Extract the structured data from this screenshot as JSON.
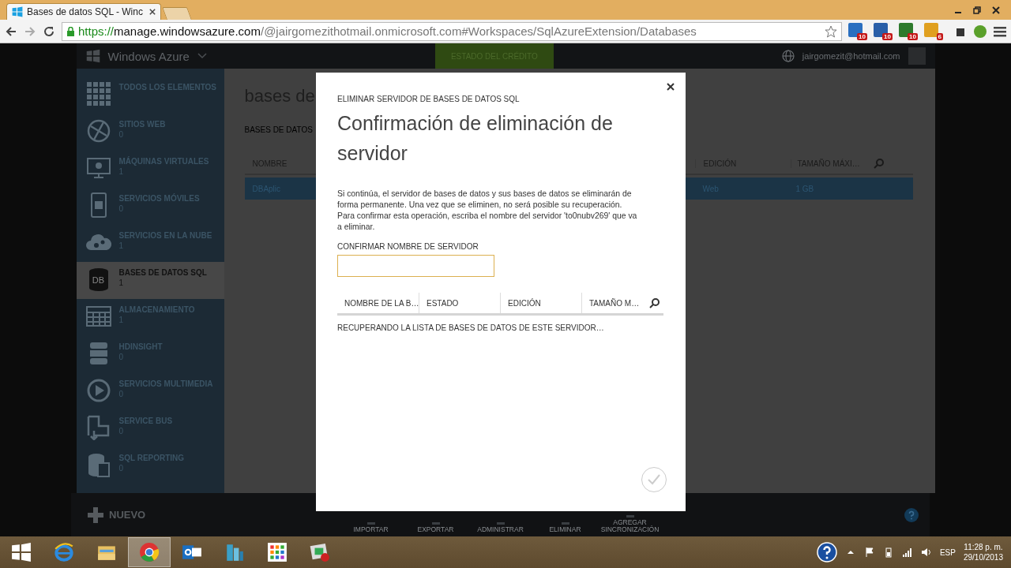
{
  "browser": {
    "tab_title": "Bases de datos SQL - Winc",
    "url_scheme": "https://",
    "url_host": "manage.windowsazure.com",
    "url_path": "/@jairgomezithotmail.onmicrosoft.com#Workspaces/SqlAzureExtension/Databases",
    "extensions": [
      {
        "badge": "10",
        "color": "#2a6fc0"
      },
      {
        "badge": "10",
        "color": "#2a5fa8"
      },
      {
        "badge": "10",
        "color": "#2d7a2d"
      },
      {
        "badge": "6",
        "color": "#e0a020"
      }
    ]
  },
  "portal": {
    "brand": "Windows Azure",
    "credit_button": "ESTADO DEL CRÉDITO",
    "user": "jairgomezit@hotmail.com"
  },
  "sidebar": {
    "items": [
      {
        "label": "TODOS LOS ELEMENTOS",
        "selected": false
      },
      {
        "label": "SITIOS WEB",
        "count": "0",
        "selected": false
      },
      {
        "label": "MÁQUINAS VIRTUALES",
        "count": "1",
        "selected": false
      },
      {
        "label": "SERVICIOS MÓVILES",
        "count": "0",
        "selected": false
      },
      {
        "label": "SERVICIOS EN LA NUBE",
        "count": "1",
        "selected": false
      },
      {
        "label": "BASES DE DATOS SQL",
        "count": "1",
        "selected": true,
        "icon_label": "DB"
      },
      {
        "label": "ALMACENAMIENTO",
        "count": "1",
        "selected": false
      },
      {
        "label": "HDINSIGHT",
        "count": "0",
        "selected": false
      },
      {
        "label": "SERVICIOS MULTIMEDIA",
        "count": "0",
        "selected": false
      },
      {
        "label": "SERVICE BUS",
        "count": "0",
        "selected": false
      },
      {
        "label": "SQL REPORTING",
        "count": "0",
        "selected": false
      }
    ]
  },
  "main": {
    "title": "bases de",
    "subtab": "BASES DE DATOS",
    "columns": [
      "NOMBRE",
      "EDICIÓN",
      "TAMAÑO MÁXI…"
    ],
    "rows": [
      {
        "cells": [
          "DBAplic",
          "Web",
          "1 GB"
        ],
        "selected": true
      }
    ]
  },
  "dialog": {
    "eyebrow": "ELIMINAR SERVIDOR DE BASES DE DATOS SQL",
    "title": "Confirmación de eliminación de servidor",
    "body": "Si continúa, el servidor de bases de datos y sus bases de datos se eliminarán de forma permanente. Una vez que se eliminen, no será posible su recuperación. Para confirmar esta operación, escriba el nombre del servidor 'to0nubv269' que va a eliminar.",
    "field_label": "CONFIRMAR NOMBRE DE SERVIDOR",
    "columns": [
      "NOMBRE DE LA B…",
      "ESTADO",
      "EDICIÓN",
      "TAMAÑO M…"
    ],
    "status": "RECUPERANDO LA LISTA DE BASES DE DATOS DE ESTE SERVIDOR…",
    "confirm_disabled": true
  },
  "command_bar": {
    "new_label": "NUEVO",
    "commands": [
      "IMPORTAR",
      "EXPORTAR",
      "ADMINISTRAR",
      "ELIMINAR",
      "AGREGAR SINCRONIZACIÓN"
    ]
  },
  "taskbar": {
    "apps": [
      {
        "selected": false
      },
      {
        "selected": false
      },
      {
        "selected": false
      },
      {
        "selected": true
      },
      {
        "selected": false
      },
      {
        "selected": false
      },
      {
        "selected": false
      },
      {
        "selected": false
      }
    ],
    "language": "ESP",
    "time": "11:28 p. m.",
    "date": "29/10/2013"
  }
}
